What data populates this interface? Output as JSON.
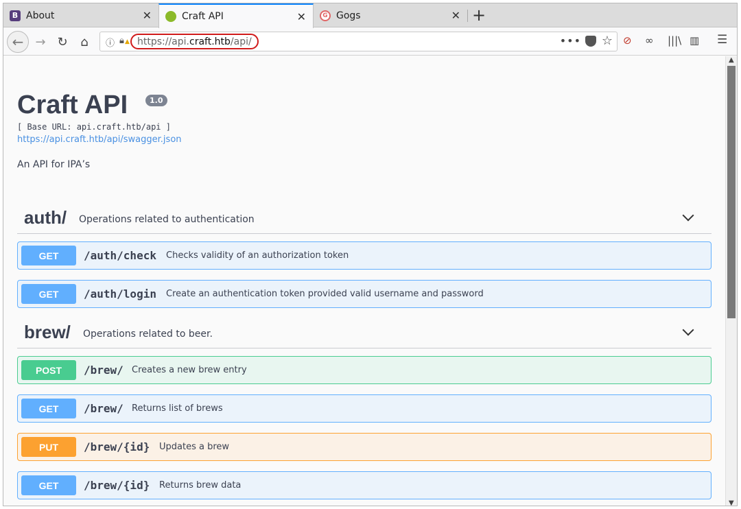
{
  "tabs": [
    {
      "label": "About",
      "favicon": "B"
    },
    {
      "label": "Craft API",
      "favicon": ""
    },
    {
      "label": "Gogs",
      "favicon": "G"
    }
  ],
  "url": {
    "scheme": "https://api.",
    "host": "craft.htb",
    "path": "/api/"
  },
  "api": {
    "title": "Craft API",
    "version": "1.0",
    "base_url": "[ Base URL: api.craft.htb/api ]",
    "spec_url": "https://api.craft.htb/api/swagger.json",
    "description": "An API for IPA’s"
  },
  "sections": [
    {
      "name": "auth/",
      "description": "Operations related to authentication"
    },
    {
      "name": "brew/",
      "description": "Operations related to beer."
    }
  ],
  "operations": [
    {
      "method": "GET",
      "path": "/auth/check",
      "summary": "Checks validity of an authorization token"
    },
    {
      "method": "GET",
      "path": "/auth/login",
      "summary": "Create an authentication token provided valid username and password"
    },
    {
      "method": "POST",
      "path": "/brew/",
      "summary": "Creates a new brew entry"
    },
    {
      "method": "GET",
      "path": "/brew/",
      "summary": "Returns list of brews"
    },
    {
      "method": "PUT",
      "path": "/brew/{id}",
      "summary": "Updates a brew"
    },
    {
      "method": "GET",
      "path": "/brew/{id}",
      "summary": "Returns brew data"
    }
  ],
  "colors": {
    "get": "#61affe",
    "post": "#49cc90",
    "put": "#fca130",
    "url_highlight": "#d01a1a"
  }
}
